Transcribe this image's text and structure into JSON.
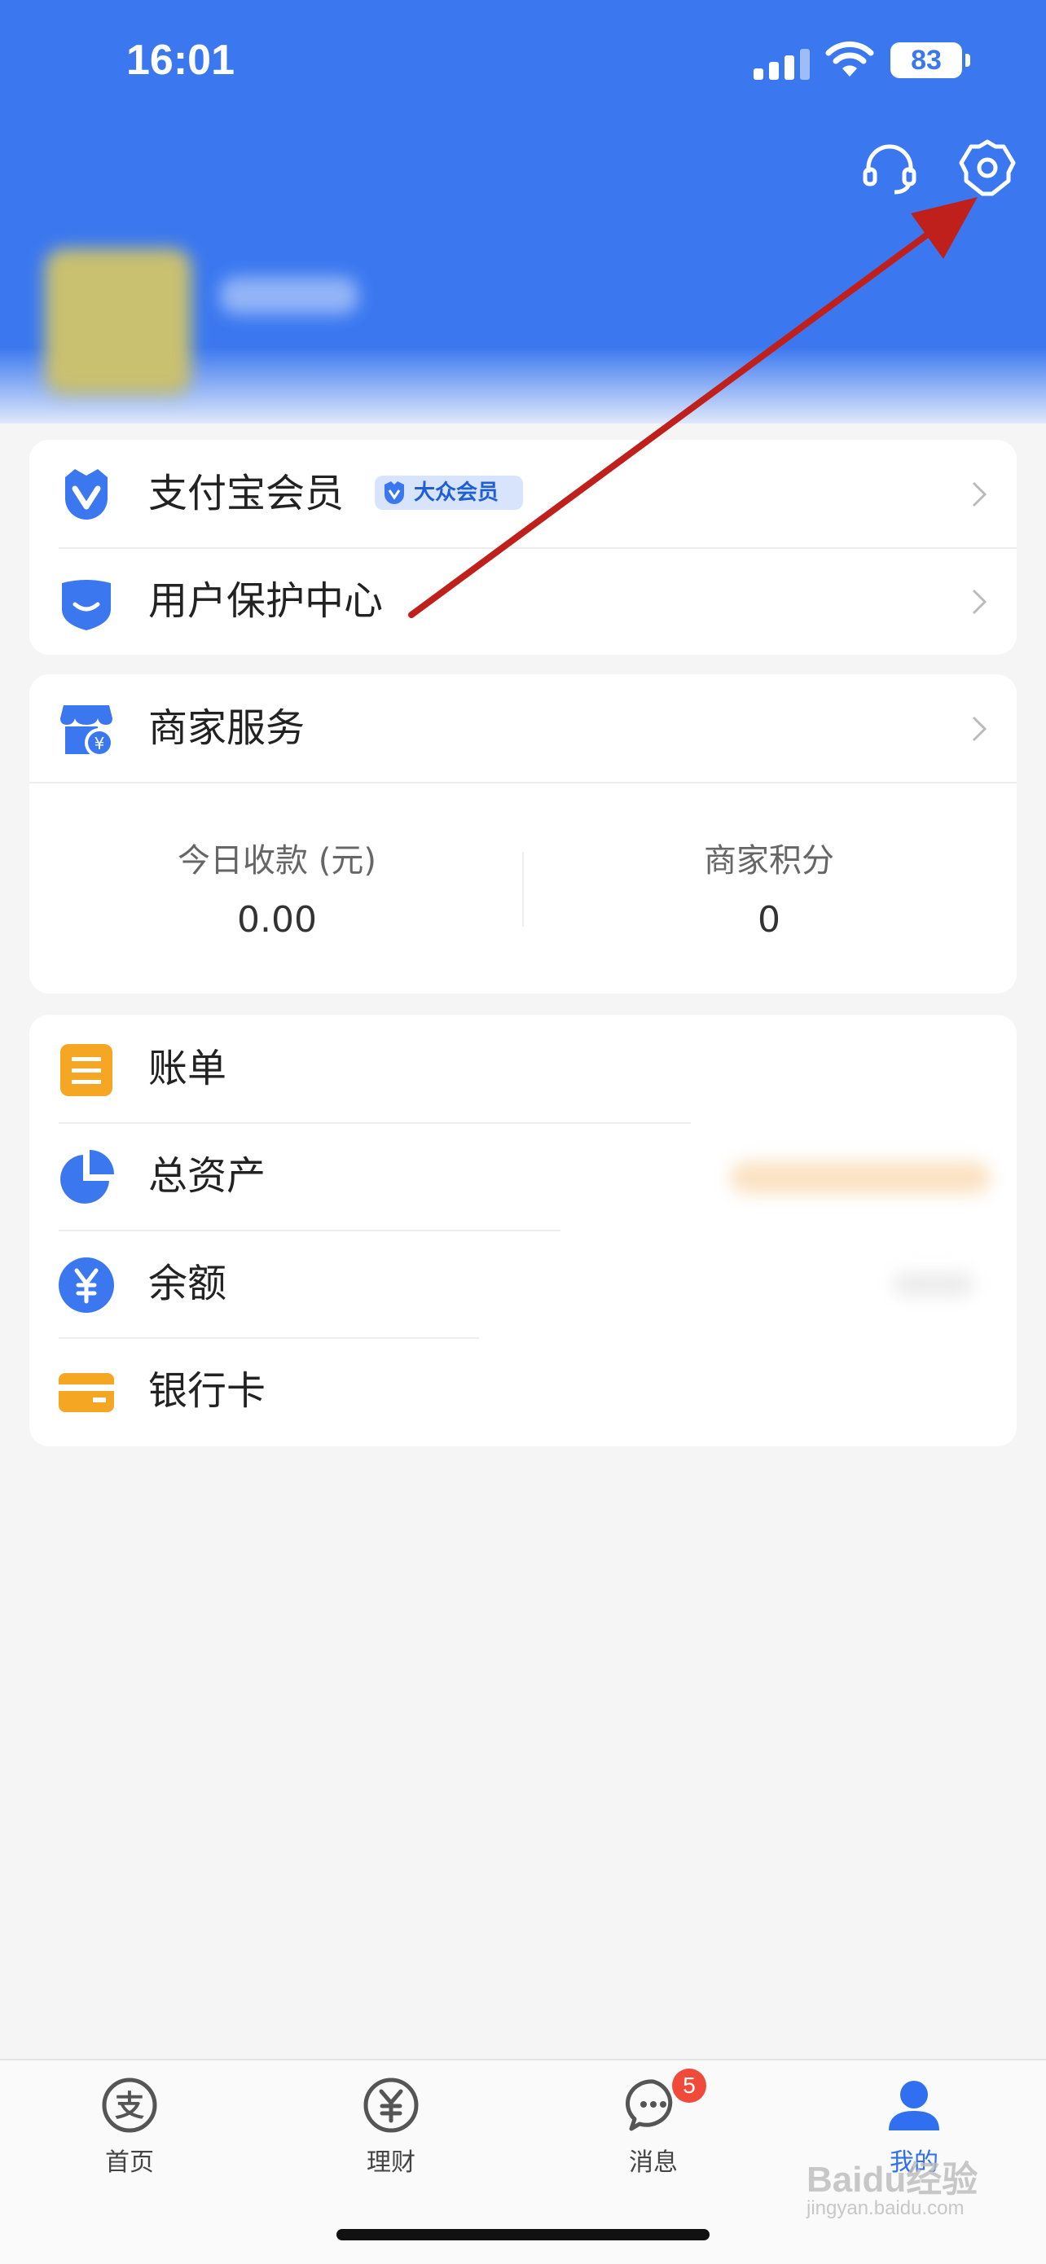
{
  "status_bar": {
    "time": "16:01",
    "battery": "83"
  },
  "membership_card": {
    "items": [
      {
        "label": "支付宝会员",
        "badge": "大众会员"
      },
      {
        "label": "用户保护中心"
      }
    ]
  },
  "merchant_card": {
    "title": "商家服务",
    "stats": [
      {
        "title": "今日收款 (元)",
        "value": "0.00"
      },
      {
        "title": "商家积分",
        "value": "0"
      }
    ]
  },
  "assets_card": {
    "items": [
      {
        "label": "账单"
      },
      {
        "label": "总资产"
      },
      {
        "label": "余额"
      },
      {
        "label": "银行卡"
      }
    ]
  },
  "tab_bar": {
    "tabs": [
      {
        "label": "首页"
      },
      {
        "label": "理财"
      },
      {
        "label": "消息",
        "badge": "5"
      },
      {
        "label": "我的"
      }
    ]
  },
  "watermark": {
    "brand": "Baidu经验",
    "url": "jingyan.baidu.com"
  },
  "colors": {
    "primary": "#3b78f0",
    "active_tab": "#2f6ff0",
    "accent_orange": "#f5a623",
    "badge_red": "#f04a3a",
    "annotation_arrow": "#c0201b"
  },
  "icons": [
    "headset-icon",
    "settings-gear-icon",
    "member-v-icon",
    "shield-icon",
    "store-icon",
    "bill-icon",
    "pie-chart-icon",
    "yuan-icon",
    "bank-card-icon"
  ]
}
